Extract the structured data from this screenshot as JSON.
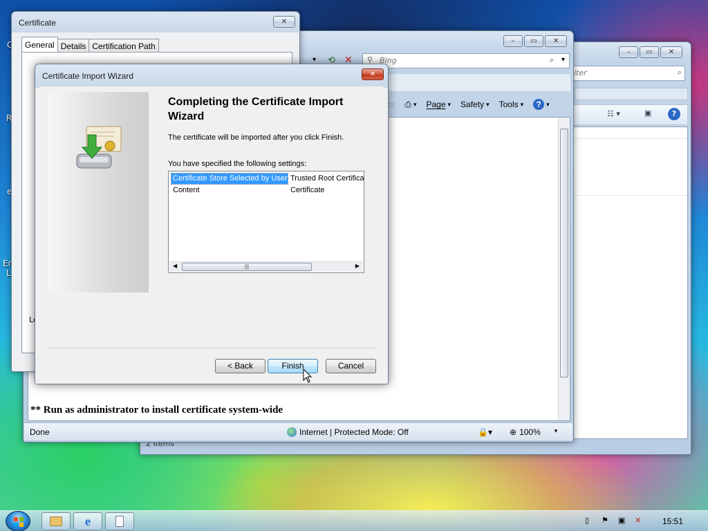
{
  "desktop": {
    "fragments": [
      "C",
      "R",
      "e",
      "En",
      "L"
    ]
  },
  "explorer": {
    "search_placeholder": "iter",
    "status": "2 items"
  },
  "ie": {
    "search_placeholder": "Bing",
    "cmd": {
      "page": "Page",
      "safety": "Safety",
      "tools": "Tools"
    },
    "content_line": "** Run as administrator to install certificate system-wide",
    "status_done": "Done",
    "status_zone": "Internet | Protected Mode: Off",
    "zoom": "100%"
  },
  "cert_window": {
    "title": "Certificate",
    "tabs": [
      "General",
      "Details",
      "Certification Path"
    ],
    "fragment": "Le"
  },
  "wizard": {
    "title": "Certificate Import Wizard",
    "heading": "Completing the Certificate Import Wizard",
    "intro": "The certificate will be imported after you click Finish.",
    "settings_label": "You have specified the following settings:",
    "settings": [
      {
        "key": "Certificate Store Selected by User",
        "value": "Trusted Root Certifica",
        "selected": true
      },
      {
        "key": "Content",
        "value": "Certificate",
        "selected": false
      }
    ],
    "buttons": {
      "back": "< Back",
      "finish": "Finish",
      "cancel": "Cancel"
    }
  },
  "taskbar": {
    "clock": "15:51"
  },
  "colors": {
    "selection": "#3399ff",
    "close_red": "#c0391f"
  }
}
